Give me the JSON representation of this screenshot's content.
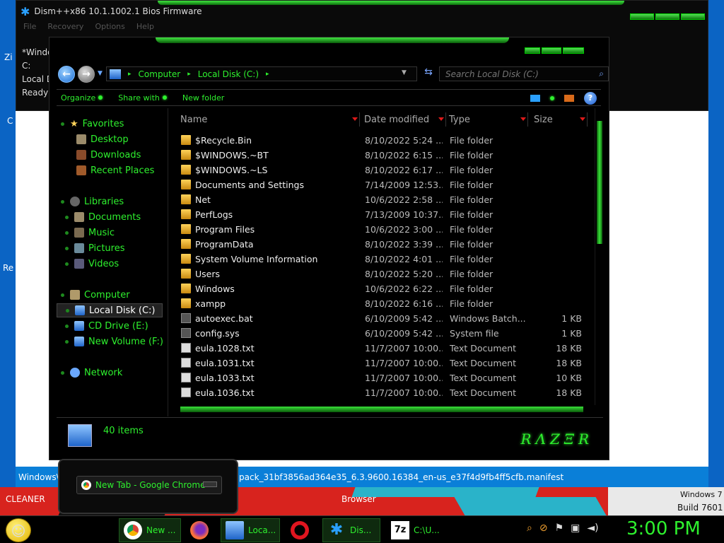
{
  "dism": {
    "title": "Dism++x86 10.1.1002.1 Bios Firmware",
    "menu": [
      "File",
      "Recovery",
      "Options",
      "Help"
    ],
    "side_lines": [
      "*Windo",
      "C:",
      "Local D",
      "Ready"
    ]
  },
  "desktop": {
    "left_letters": [
      "Zi",
      "C",
      "Re"
    ],
    "cleaner": "CLEANER",
    "browser": "Browser",
    "windows7": "Windows 7",
    "build": "Build 7601"
  },
  "pathbar": {
    "left": "Windows\\",
    "text": "pack_31bf3856ad364e35_6.3.9600.16384_en-us_e37f4d9fb4ff5cfb.manifest"
  },
  "explorer": {
    "address": [
      "Computer",
      "Local Disk (C:)"
    ],
    "search_placeholder": "Search Local Disk (C:)",
    "commands": {
      "organize": "Organize",
      "share": "Share with",
      "new_folder": "New folder"
    },
    "nav": {
      "favorites": "Favorites",
      "desktop": "Desktop",
      "downloads": "Downloads",
      "recent": "Recent Places",
      "libraries": "Libraries",
      "documents": "Documents",
      "music": "Music",
      "pictures": "Pictures",
      "videos": "Videos",
      "computer": "Computer",
      "local_disk": "Local Disk (C:)",
      "cd_drive": "CD Drive (E:)",
      "new_volume": "New Volume (F:)",
      "network": "Network"
    },
    "columns": {
      "name": "Name",
      "date": "Date modified",
      "type": "Type",
      "size": "Size"
    },
    "files": [
      {
        "name": "$Recycle.Bin",
        "date": "8/10/2022 5:24 ...",
        "type": "File folder",
        "size": "",
        "kind": "folder"
      },
      {
        "name": "$WINDOWS.~BT",
        "date": "8/10/2022 6:15 ...",
        "type": "File folder",
        "size": "",
        "kind": "folder"
      },
      {
        "name": "$WINDOWS.~LS",
        "date": "8/10/2022 6:17 ...",
        "type": "File folder",
        "size": "",
        "kind": "folder"
      },
      {
        "name": "Documents and Settings",
        "date": "7/14/2009 12:53...",
        "type": "File folder",
        "size": "",
        "kind": "folder"
      },
      {
        "name": "Net",
        "date": "10/6/2022 2:58 ...",
        "type": "File folder",
        "size": "",
        "kind": "folder"
      },
      {
        "name": "PerfLogs",
        "date": "7/13/2009 10:37...",
        "type": "File folder",
        "size": "",
        "kind": "folder"
      },
      {
        "name": "Program Files",
        "date": "10/6/2022 3:00 ...",
        "type": "File folder",
        "size": "",
        "kind": "folder"
      },
      {
        "name": "ProgramData",
        "date": "8/10/2022 3:39 ...",
        "type": "File folder",
        "size": "",
        "kind": "folder"
      },
      {
        "name": "System Volume Information",
        "date": "8/10/2022 4:01 ...",
        "type": "File folder",
        "size": "",
        "kind": "folder"
      },
      {
        "name": "Users",
        "date": "8/10/2022 5:20 ...",
        "type": "File folder",
        "size": "",
        "kind": "folder"
      },
      {
        "name": "Windows",
        "date": "10/6/2022 6:22 ...",
        "type": "File folder",
        "size": "",
        "kind": "folder"
      },
      {
        "name": "xampp",
        "date": "8/10/2022 6:16 ...",
        "type": "File folder",
        "size": "",
        "kind": "folder"
      },
      {
        "name": "autoexec.bat",
        "date": "6/10/2009 5:42 ...",
        "type": "Windows Batch...",
        "size": "1 KB",
        "kind": "bat"
      },
      {
        "name": "config.sys",
        "date": "6/10/2009 5:42 ...",
        "type": "System file",
        "size": "1 KB",
        "kind": "bat"
      },
      {
        "name": "eula.1028.txt",
        "date": "11/7/2007 10:00...",
        "type": "Text Document",
        "size": "18 KB",
        "kind": "file"
      },
      {
        "name": "eula.1031.txt",
        "date": "11/7/2007 10:00...",
        "type": "Text Document",
        "size": "18 KB",
        "kind": "file"
      },
      {
        "name": "eula.1033.txt",
        "date": "11/7/2007 10:00...",
        "type": "Text Document",
        "size": "10 KB",
        "kind": "file"
      },
      {
        "name": "eula.1036.txt",
        "date": "11/7/2007 10:00...",
        "type": "Text Document",
        "size": "18 KB",
        "kind": "file"
      }
    ],
    "status": "40 items",
    "brand": "RAZER"
  },
  "thumbnail": {
    "title": "New Tab - Google Chrome"
  },
  "taskbar": {
    "items": [
      {
        "label": "New ...",
        "icon": "chrome-icon"
      },
      {
        "label": "",
        "icon": "firefox-icon"
      },
      {
        "label": "Loca...",
        "icon": "drive-icon"
      },
      {
        "label": "",
        "icon": "opera-icon"
      },
      {
        "label": "Dis...",
        "icon": "gear-icon"
      },
      {
        "label": "C:\\U...",
        "icon": "7zip-icon"
      }
    ],
    "clock": "3:00 PM"
  },
  "colors": {
    "accent": "#2ef02e",
    "selection": "#222222",
    "desktop_blue": "#0b64c4"
  }
}
